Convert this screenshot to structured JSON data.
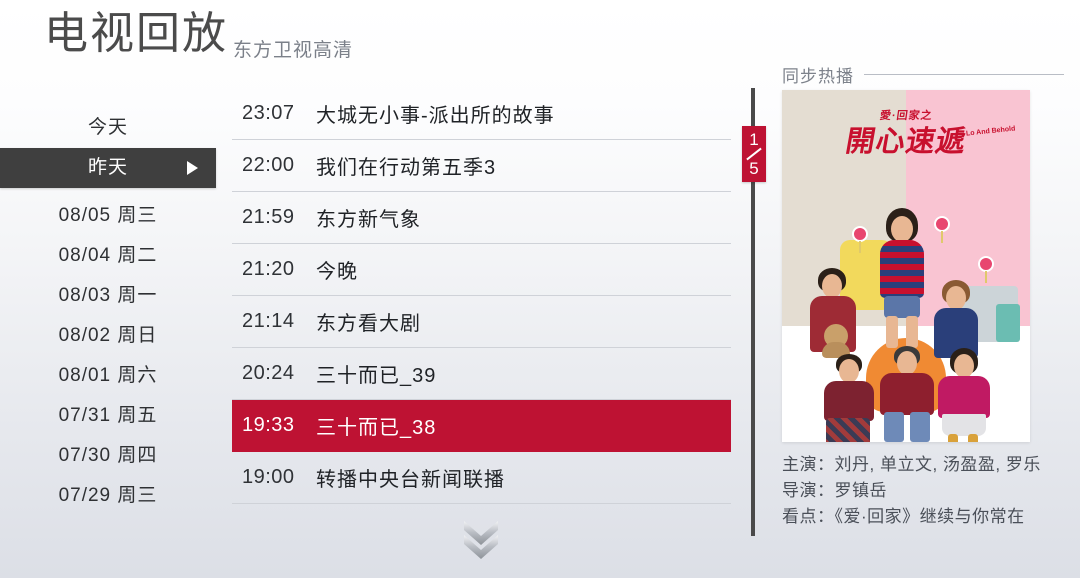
{
  "header": {
    "title": "电视回放",
    "channel": "东方卫视高清"
  },
  "date_sidebar": {
    "items": [
      {
        "label": "今天",
        "selected": false
      },
      {
        "label": "昨天",
        "selected": true
      },
      {
        "label": "08/05  周三",
        "selected": false
      },
      {
        "label": "08/04  周二",
        "selected": false
      },
      {
        "label": "08/03  周一",
        "selected": false
      },
      {
        "label": "08/02  周日",
        "selected": false
      },
      {
        "label": "08/01  周六",
        "selected": false
      },
      {
        "label": "07/31  周五",
        "selected": false
      },
      {
        "label": "07/30  周四",
        "selected": false
      },
      {
        "label": "07/29  周三",
        "selected": false
      }
    ]
  },
  "program_list": {
    "rows": [
      {
        "time": "23:07",
        "name": "大城无小事-派出所的故事",
        "selected": false
      },
      {
        "time": "22:00",
        "name": "我们在行动第五季3",
        "selected": false
      },
      {
        "time": "21:59",
        "name": "东方新气象",
        "selected": false
      },
      {
        "time": "21:20",
        "name": "今晚",
        "selected": false
      },
      {
        "time": "21:14",
        "name": "东方看大剧",
        "selected": false
      },
      {
        "time": "20:24",
        "name": "三十而已_39",
        "selected": false
      },
      {
        "time": "19:33",
        "name": "三十而已_38",
        "selected": true
      },
      {
        "time": "19:00",
        "name": "转播中央台新闻联播",
        "selected": false
      }
    ],
    "scroll_more_icon": "chevron-double-down-icon"
  },
  "promo": {
    "section_title": "同步热播",
    "pagination": {
      "current": "1",
      "total": "5"
    },
    "poster": {
      "logo_small": "愛·回家之",
      "logo_big": "開心速遞",
      "logo_en": "Lo And Behold"
    },
    "info": [
      {
        "label": "主演：",
        "value": "刘丹, 单立文, 汤盈盈, 罗乐"
      },
      {
        "label": "导演：",
        "value": "罗镇岳"
      },
      {
        "label": "看点：",
        "value": "《爱·回家》继续与你常在"
      }
    ]
  },
  "colors": {
    "accent_red": "#be1233",
    "selected_dark": "#3f3f3f",
    "title_gray": "#4b4b4b"
  }
}
